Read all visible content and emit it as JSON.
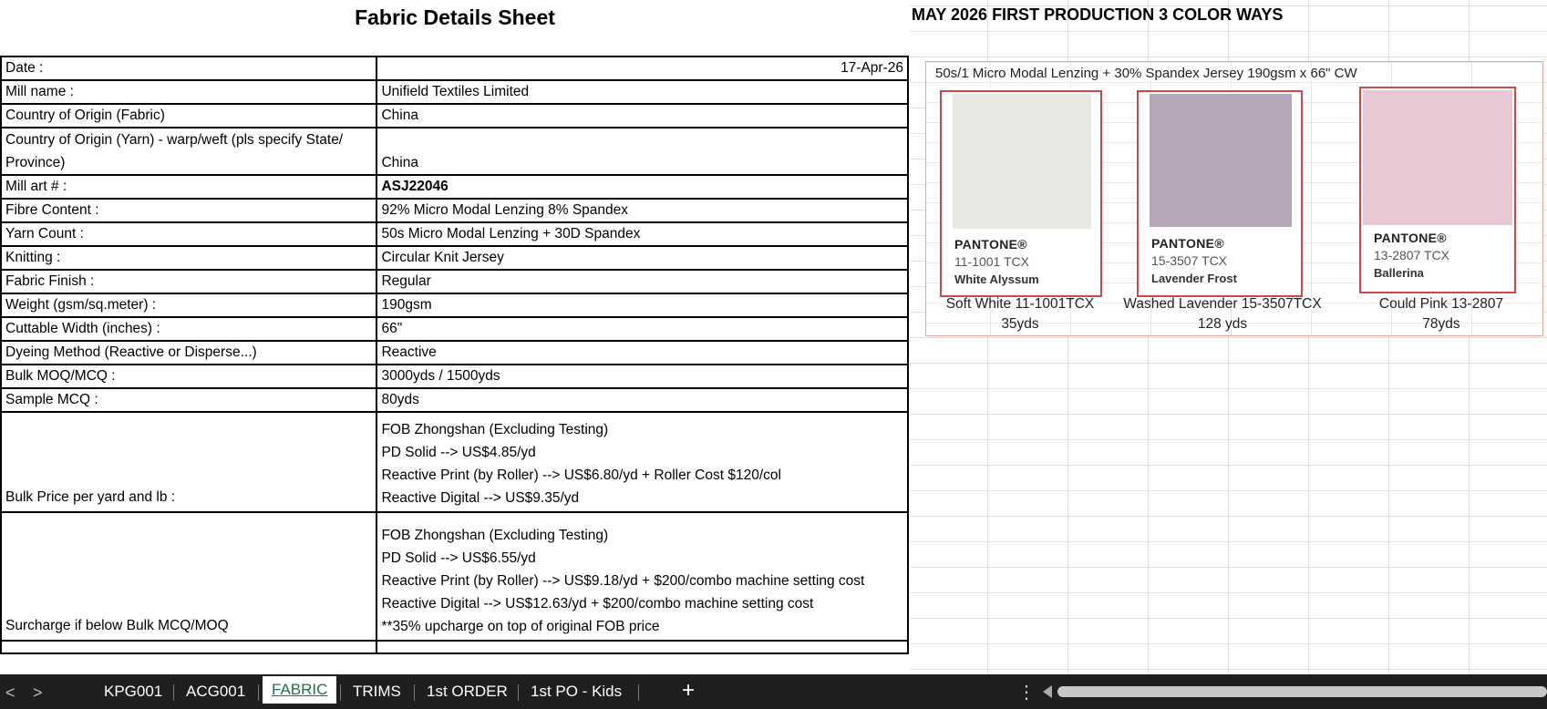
{
  "sheet": {
    "title": "Fabric Details Sheet",
    "right_title": "MAY 2026 FIRST PRODUCTION 3 COLOR WAYS",
    "rows": [
      {
        "label": "Date :",
        "value": "17-Apr-26"
      },
      {
        "label": "Mill name :",
        "value": "Unifield Textiles Limited"
      },
      {
        "label": "Country of Origin (Fabric)",
        "value": "China"
      },
      {
        "label_line1": "Country of Origin (Yarn) - warp/weft (pls specify State/",
        "label_line2": "Province)",
        "value": "China"
      },
      {
        "label": "Mill art # :",
        "value": "ASJ22046"
      },
      {
        "label": "Fibre Content :",
        "value": "92% Micro Modal Lenzing 8% Spandex"
      },
      {
        "label": "Yarn Count :",
        "value": "50s Micro Modal Lenzing + 30D Spandex"
      },
      {
        "label": "Knitting :",
        "value": "Circular Knit Jersey"
      },
      {
        "label": "Fabric Finish :",
        "value": "Regular"
      },
      {
        "label": "Weight (gsm/sq.meter) :",
        "value": "190gsm"
      },
      {
        "label": "Cuttable Width (inches) :",
        "value": "66\""
      },
      {
        "label": "Dyeing Method (Reactive or Disperse...)",
        "value": "Reactive"
      },
      {
        "label": "Bulk MOQ/MCQ :",
        "value": "3000yds / 1500yds"
      },
      {
        "label": "Sample MCQ :",
        "value": "80yds"
      }
    ],
    "bulk_price": {
      "label": "Bulk Price per yard and lb :",
      "lines": [
        "FOB Zhongshan (Excluding Testing)",
        "PD Solid --> US$4.85/yd",
        "Reactive Print (by Roller) --> US$6.80/yd + Roller Cost $120/col",
        "Reactive Digital --> US$9.35/yd"
      ]
    },
    "surcharge": {
      "label": "Surcharge if below Bulk MCQ/MOQ",
      "lines": [
        "FOB Zhongshan (Excluding Testing)",
        "PD Solid --> US$6.55/yd",
        "Reactive Print (by Roller) --> US$9.18/yd + $200/combo machine setting cost",
        "Reactive Digital --> US$12.63/yd + $200/combo machine setting cost",
        "**35% upcharge on top of original FOB price"
      ]
    }
  },
  "swatches": {
    "panel_title": "50s/1 Micro Modal  Lenzing + 30% Spandex Jersey 190gsm x 66\" CW",
    "items": [
      {
        "brand": "PANTONE®",
        "code": "11-1001 TCX",
        "name": "White Alyssum",
        "color": "#e9e8e3",
        "label": "Soft White 11-1001TCX",
        "qty": "35yds"
      },
      {
        "brand": "PANTONE®",
        "code": "15-3507 TCX",
        "name": "Lavender Frost",
        "color": "#b6a6b9",
        "label": "Washed Lavender 15-3507TCX",
        "qty": "128 yds"
      },
      {
        "brand": "PANTONE®",
        "code": "13-2807 TCX",
        "name": "Ballerina",
        "color": "#e9c8d6",
        "label": "Could Pink 13-2807",
        "qty": "78yds"
      }
    ]
  },
  "tabs": {
    "items": [
      "KPG001",
      "ACG001",
      "FABRIC",
      "TRIMS",
      "1st ORDER",
      "1st PO - Kids"
    ],
    "active": "FABRIC",
    "prev": "<",
    "next": ">",
    "add": "+",
    "more": "⋮"
  }
}
